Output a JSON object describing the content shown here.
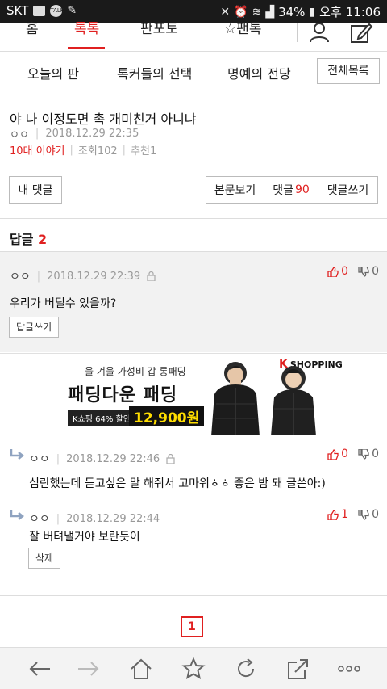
{
  "status_bar": {
    "carrier": "SKT",
    "battery": "34%",
    "ampm": "오후",
    "time": "11:06"
  },
  "top_nav": {
    "tabs": [
      "홈",
      "톡톡",
      "판포토",
      "☆팬톡"
    ],
    "active_tab": "톡톡"
  },
  "sub_nav": {
    "items": [
      "오늘의 판",
      "톡커들의 선택",
      "명예의 전당"
    ],
    "all_list_label": "전체목록"
  },
  "post": {
    "title": "야 나 이정도면 촉 개미친거 아니냐",
    "author": "ㅇㅇ",
    "date": "2018.12.29 22:35",
    "category": "10대 이야기",
    "views": "조회102",
    "recommends": "추천1"
  },
  "actions": {
    "my_comments": "내 댓글",
    "view_post": "본문보기",
    "comments_label": "댓글",
    "comments_count": "90",
    "write_comment": "댓글쓰기"
  },
  "replies_header": {
    "label": "답글",
    "count": "2"
  },
  "main_comment": {
    "nick": "ㅇㅇ",
    "date": "2018.12.29 22:39",
    "up": "0",
    "down": "0",
    "text": "우리가 버틸수 있을까?",
    "reply_button": "답글쓰기"
  },
  "ad": {
    "line1": "올 겨울 가성비 갑 롱패딩",
    "line2": "패딩다운 패딩",
    "badge": "K쇼핑 64% 할인",
    "price": "12,900원",
    "brand": "SHOPPING",
    "brand_k": "K"
  },
  "replies": [
    {
      "nick": "ㅇㅇ",
      "date": "2018.12.29 22:46",
      "up": "0",
      "down": "0",
      "text": "심란했는데 듣고싶은 말 해줘서 고마워ㅎㅎ 좋은 밤 돼 글쓴아:)"
    },
    {
      "nick": "ㅇㅇ",
      "date": "2018.12.29 22:44",
      "up": "1",
      "down": "0",
      "text": "잘 버텨낼거야 보란듯이",
      "delete_button": "삭제"
    }
  ],
  "pager": {
    "current": "1"
  },
  "colors": {
    "accent": "#e02020"
  },
  "bottom_bar": {
    "icons": [
      "back-arrow-icon",
      "forward-arrow-icon",
      "home-icon",
      "bookmark-star-icon",
      "refresh-icon",
      "share-icon",
      "more-icon"
    ]
  }
}
